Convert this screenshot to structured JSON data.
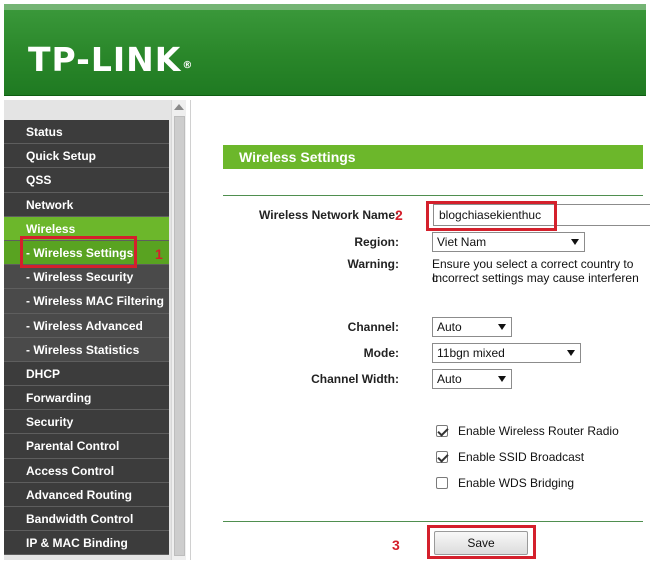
{
  "header": {
    "logo": "TP-LINK",
    "logo_mark": "®"
  },
  "sidebar": {
    "items": [
      {
        "label": "Status"
      },
      {
        "label": "Quick Setup"
      },
      {
        "label": "QSS"
      },
      {
        "label": "Network"
      },
      {
        "label": "Wireless"
      },
      {
        "label": "- Wireless Settings"
      },
      {
        "label": "- Wireless Security"
      },
      {
        "label": "- Wireless MAC Filtering"
      },
      {
        "label": "- Wireless Advanced"
      },
      {
        "label": "- Wireless Statistics"
      },
      {
        "label": "DHCP"
      },
      {
        "label": "Forwarding"
      },
      {
        "label": "Security"
      },
      {
        "label": "Parental Control"
      },
      {
        "label": "Access Control"
      },
      {
        "label": "Advanced Routing"
      },
      {
        "label": "Bandwidth Control"
      },
      {
        "label": "IP & MAC Binding"
      }
    ]
  },
  "main": {
    "title": "Wireless Settings",
    "fields": {
      "ssid_label": "Wireless Network Name:",
      "ssid_value": "blogchiasekienthuc",
      "region_label": "Region:",
      "region_value": "Viet Nam",
      "warning_label": "Warning:",
      "warning_line1": "Ensure you select a correct country to c",
      "warning_line2": "Incorrect settings may cause interferen",
      "channel_label": "Channel:",
      "channel_value": "Auto",
      "mode_label": "Mode:",
      "mode_value": "11bgn mixed",
      "width_label": "Channel Width:",
      "width_value": "Auto"
    },
    "checkboxes": [
      {
        "label": "Enable Wireless Router Radio",
        "checked": true
      },
      {
        "label": "Enable SSID Broadcast",
        "checked": true
      },
      {
        "label": "Enable WDS Bridging",
        "checked": false
      }
    ],
    "save_label": "Save"
  },
  "annotations": {
    "one": "1",
    "two": "2",
    "three": "3"
  },
  "colors": {
    "brand_green": "#2a872a",
    "accent_green": "#6cb72b",
    "highlight_red": "#d4202c"
  }
}
